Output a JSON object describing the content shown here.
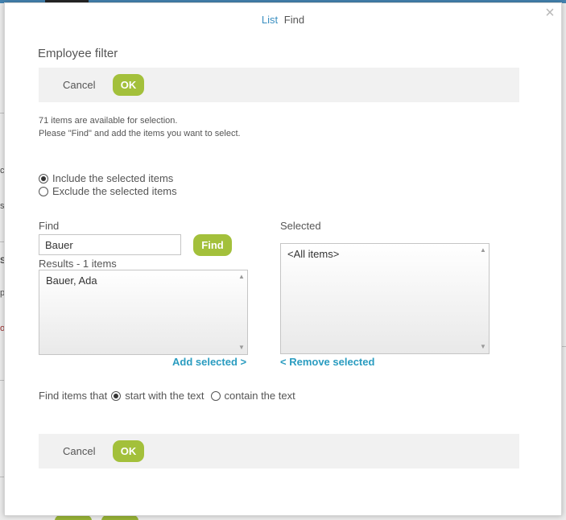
{
  "dialog": {
    "view_links": {
      "list": "List",
      "find": "Find"
    },
    "title": "Employee filter",
    "top_actions": {
      "cancel": "Cancel",
      "ok": "OK"
    },
    "info_line1": "71 items are available for selection.",
    "info_line2": "Please \"Find\" and add the items you want to select.",
    "selection_mode": {
      "include": "Include the selected items",
      "exclude": "Exclude the selected items",
      "selected": "include"
    },
    "find": {
      "label": "Find",
      "value": "Bauer",
      "button": "Find",
      "results_label": "Results - 1 items",
      "results": [
        "Bauer, Ada"
      ],
      "add_selected": "Add selected >"
    },
    "selected": {
      "label": "Selected",
      "items": [
        "<All items>"
      ],
      "remove_selected": "< Remove selected"
    },
    "match_mode": {
      "label": "Find items that",
      "start_with": "start with the text",
      "contain": "contain the text",
      "selected": "start_with"
    },
    "bottom_actions": {
      "cancel": "Cancel",
      "ok": "OK"
    }
  },
  "background": {
    "fragments": [
      "c",
      "s",
      "S",
      "p",
      "o"
    ]
  },
  "colors": {
    "accent_green": "#a3c03b",
    "link_blue": "#2a9cc0",
    "top_bar": "#4a8fbf"
  }
}
